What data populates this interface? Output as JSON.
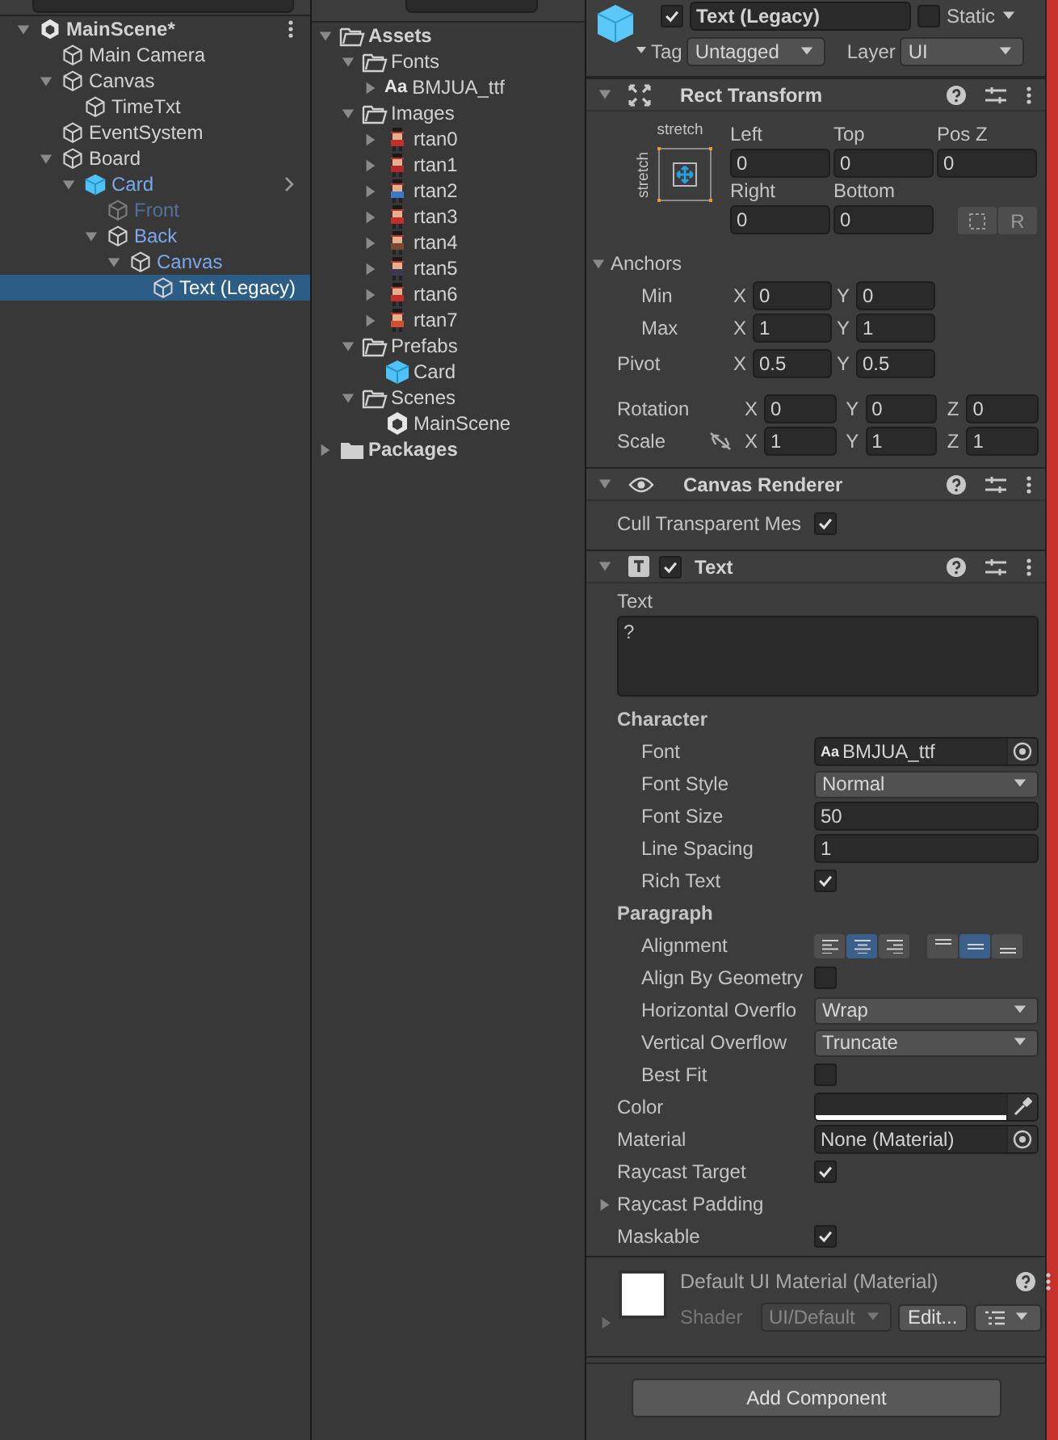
{
  "hierarchy": {
    "items": [
      {
        "name": "MainScene*",
        "kind": "scene",
        "expanded": true,
        "selected": false,
        "children": [
          {
            "name": "Main Camera",
            "kind": "object",
            "selected": false
          },
          {
            "name": "Canvas",
            "kind": "object",
            "expanded": true,
            "selected": false,
            "children": [
              {
                "name": "TimeTxt",
                "kind": "object",
                "selected": false
              }
            ]
          },
          {
            "name": "EventSystem",
            "kind": "object",
            "selected": false
          },
          {
            "name": "Board",
            "kind": "object",
            "expanded": true,
            "selected": false,
            "children": [
              {
                "name": "Card",
                "kind": "prefab",
                "prefab": true,
                "expanded": true,
                "selected": false,
                "children": [
                  {
                    "name": "Front",
                    "kind": "object",
                    "prefab": true,
                    "active": false,
                    "selected": false
                  },
                  {
                    "name": "Back",
                    "kind": "object",
                    "prefab": true,
                    "expanded": true,
                    "selected": false,
                    "children": [
                      {
                        "name": "Canvas",
                        "kind": "object",
                        "prefab": true,
                        "expanded": true,
                        "selected": false,
                        "children": [
                          {
                            "name": "Text (Legacy)",
                            "kind": "object",
                            "prefab": true,
                            "selected": true
                          }
                        ]
                      }
                    ]
                  }
                ]
              }
            ]
          }
        ]
      }
    ]
  },
  "project": {
    "items": [
      {
        "name": "Assets",
        "kind": "folder",
        "expanded": true,
        "selected": false,
        "children": [
          {
            "name": "Fonts",
            "kind": "folder",
            "expanded": true,
            "selected": false,
            "children": [
              {
                "name": "BMJUA_ttf",
                "kind": "font",
                "icon_label": "Aa",
                "expanded": false,
                "selected": false
              }
            ]
          },
          {
            "name": "Images",
            "kind": "folder",
            "expanded": true,
            "selected": false,
            "children": [
              {
                "name": "rtan0",
                "kind": "sprite",
                "expanded": false,
                "selected": false
              },
              {
                "name": "rtan1",
                "kind": "sprite",
                "expanded": false,
                "selected": false
              },
              {
                "name": "rtan2",
                "kind": "sprite",
                "expanded": false,
                "selected": false
              },
              {
                "name": "rtan3",
                "kind": "sprite",
                "expanded": false,
                "selected": false
              },
              {
                "name": "rtan4",
                "kind": "sprite",
                "expanded": false,
                "selected": false
              },
              {
                "name": "rtan5",
                "kind": "sprite",
                "expanded": false,
                "selected": false
              },
              {
                "name": "rtan6",
                "kind": "sprite",
                "expanded": false,
                "selected": false
              },
              {
                "name": "rtan7",
                "kind": "sprite",
                "expanded": false,
                "selected": false
              }
            ]
          },
          {
            "name": "Prefabs",
            "kind": "folder",
            "expanded": true,
            "selected": false,
            "children": [
              {
                "name": "Card",
                "kind": "prefab",
                "selected": false
              }
            ]
          },
          {
            "name": "Scenes",
            "kind": "folder",
            "expanded": true,
            "selected": false,
            "children": [
              {
                "name": "MainScene",
                "kind": "scene",
                "selected": false
              }
            ]
          }
        ]
      },
      {
        "name": "Packages",
        "kind": "folder",
        "expanded": false,
        "selected": false
      }
    ]
  },
  "inspector": {
    "object": {
      "active": true,
      "name": "Text (Legacy)",
      "static": false,
      "static_label": "Static",
      "tag_label": "Tag",
      "tag": "Untagged",
      "layer_label": "Layer",
      "layer": "UI"
    },
    "rect_transform": {
      "title": "Rect Transform",
      "expanded": true,
      "preset_h": "stretch",
      "preset_v": "stretch",
      "fields": [
        {
          "label": "Left",
          "value": "0"
        },
        {
          "label": "Top",
          "value": "0"
        },
        {
          "label": "Pos Z",
          "value": "0"
        },
        {
          "label": "Right",
          "value": "0"
        },
        {
          "label": "Bottom",
          "value": "0"
        }
      ],
      "raw_button": "R",
      "anchors": {
        "label": "Anchors",
        "expanded": true,
        "rows": [
          {
            "label": "Min",
            "values": [
              {
                "axis": "X",
                "value": "0"
              },
              {
                "axis": "Y",
                "value": "0"
              }
            ]
          },
          {
            "label": "Max",
            "values": [
              {
                "axis": "X",
                "value": "1"
              },
              {
                "axis": "Y",
                "value": "1"
              }
            ]
          }
        ]
      },
      "pivot": {
        "label": "Pivot",
        "values": [
          {
            "axis": "X",
            "value": "0.5"
          },
          {
            "axis": "Y",
            "value": "0.5"
          }
        ]
      },
      "rotation": {
        "label": "Rotation",
        "values": [
          {
            "axis": "X",
            "value": "0"
          },
          {
            "axis": "Y",
            "value": "0"
          },
          {
            "axis": "Z",
            "value": "0"
          }
        ]
      },
      "scale": {
        "label": "Scale",
        "linked": false,
        "values": [
          {
            "axis": "X",
            "value": "1"
          },
          {
            "axis": "Y",
            "value": "1"
          },
          {
            "axis": "Z",
            "value": "1"
          }
        ]
      }
    },
    "canvas_renderer": {
      "title": "Canvas Renderer",
      "expanded": true,
      "rows": [
        {
          "kind": "checkbox",
          "label": "Cull Transparent Mes",
          "checked": true
        }
      ]
    },
    "text": {
      "title": "Text",
      "enabled": true,
      "expanded": true,
      "rows": [
        {
          "kind": "textarea",
          "label": "Text",
          "value": "?"
        },
        {
          "kind": "header",
          "label": "Character",
          "children": [
            {
              "kind": "object",
              "label": "Font",
              "value": "BMJUA_ttf",
              "icon_label": "Aa"
            },
            {
              "kind": "dropdown",
              "label": "Font Style",
              "value": "Normal"
            },
            {
              "kind": "input",
              "label": "Font Size",
              "value": "50"
            },
            {
              "kind": "input",
              "label": "Line Spacing",
              "value": "1"
            },
            {
              "kind": "checkbox",
              "label": "Rich Text",
              "checked": true
            }
          ]
        },
        {
          "kind": "header",
          "label": "Paragraph",
          "children": [
            {
              "kind": "alignment",
              "label": "Alignment",
              "horizontal": [
                {
                  "selected": false
                },
                {
                  "selected": true
                },
                {
                  "selected": false
                }
              ],
              "vertical": [
                {
                  "selected": false
                },
                {
                  "selected": true
                },
                {
                  "selected": false
                }
              ]
            },
            {
              "kind": "checkbox",
              "label": "Align By Geometry",
              "checked": false
            },
            {
              "kind": "dropdown",
              "label": "Horizontal Overflo",
              "value": "Wrap"
            },
            {
              "kind": "dropdown",
              "label": "Vertical Overflow",
              "value": "Truncate"
            },
            {
              "kind": "checkbox",
              "label": "Best Fit",
              "checked": false
            }
          ]
        },
        {
          "kind": "color",
          "label": "Color",
          "color": "#2b2b2b"
        },
        {
          "kind": "object",
          "label": "Material",
          "value": "None (Material)"
        },
        {
          "kind": "checkbox",
          "label": "Raycast Target",
          "checked": true
        },
        {
          "kind": "foldout",
          "label": "Raycast Padding",
          "expanded": false
        },
        {
          "kind": "checkbox",
          "label": "Maskable",
          "checked": true
        }
      ]
    },
    "material": {
      "name": "Default UI Material (Material)",
      "expanded": false,
      "shader_label": "Shader",
      "shader": "UI/Default",
      "edit_button": "Edit..."
    },
    "add_component": "Add Component"
  }
}
